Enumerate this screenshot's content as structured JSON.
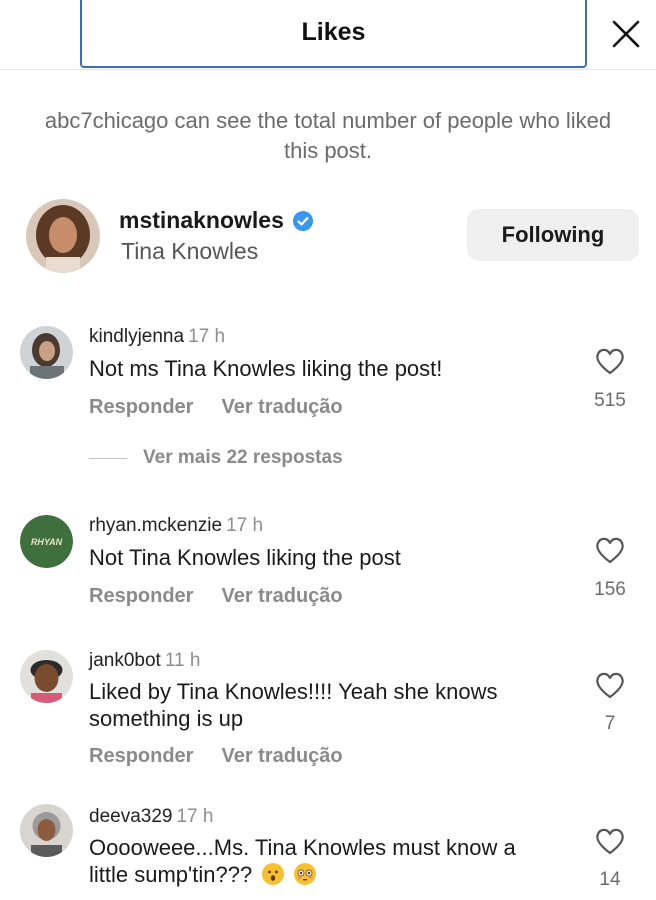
{
  "header": {
    "title": "Likes"
  },
  "notice": "abc7chicago can see the total number of people who liked this post.",
  "profile": {
    "username": "mstinaknowles",
    "display_name": "Tina Knowles",
    "follow_label": "Following",
    "verified": true
  },
  "comments": [
    {
      "username": "kindlyjenna",
      "time": "17 h",
      "text": "Not ms Tina Knowles liking the post!",
      "reply_label": "Responder",
      "translate_label": "Ver tradução",
      "likes": "515"
    },
    {
      "username": "rhyan.mckenzie",
      "time": "17 h",
      "text": "Not Tina Knowles liking the post",
      "reply_label": "Responder",
      "translate_label": "Ver tradução",
      "likes": "156",
      "avatar_text": "RHYAN"
    },
    {
      "username": "jank0bot",
      "time": "11 h",
      "text": "Liked by Tina Knowles!!!! Yeah she knows something is up",
      "reply_label": "Responder",
      "translate_label": "Ver tradução",
      "likes": "7"
    },
    {
      "username": "deeva329",
      "time": "17 h",
      "text": "Ooooweee...Ms. Tina Knowles must know a little sump'tin???",
      "likes": "14",
      "emojis": [
        "hushed-face-emoji",
        "flushed-face-emoji"
      ]
    }
  ],
  "more_replies": "Ver mais 22 respostas",
  "colors": {
    "verified": "#3897f0",
    "accent_border": "#3d6fb6",
    "button_bg": "#efefef",
    "muted_text": "#8a8a8a"
  }
}
